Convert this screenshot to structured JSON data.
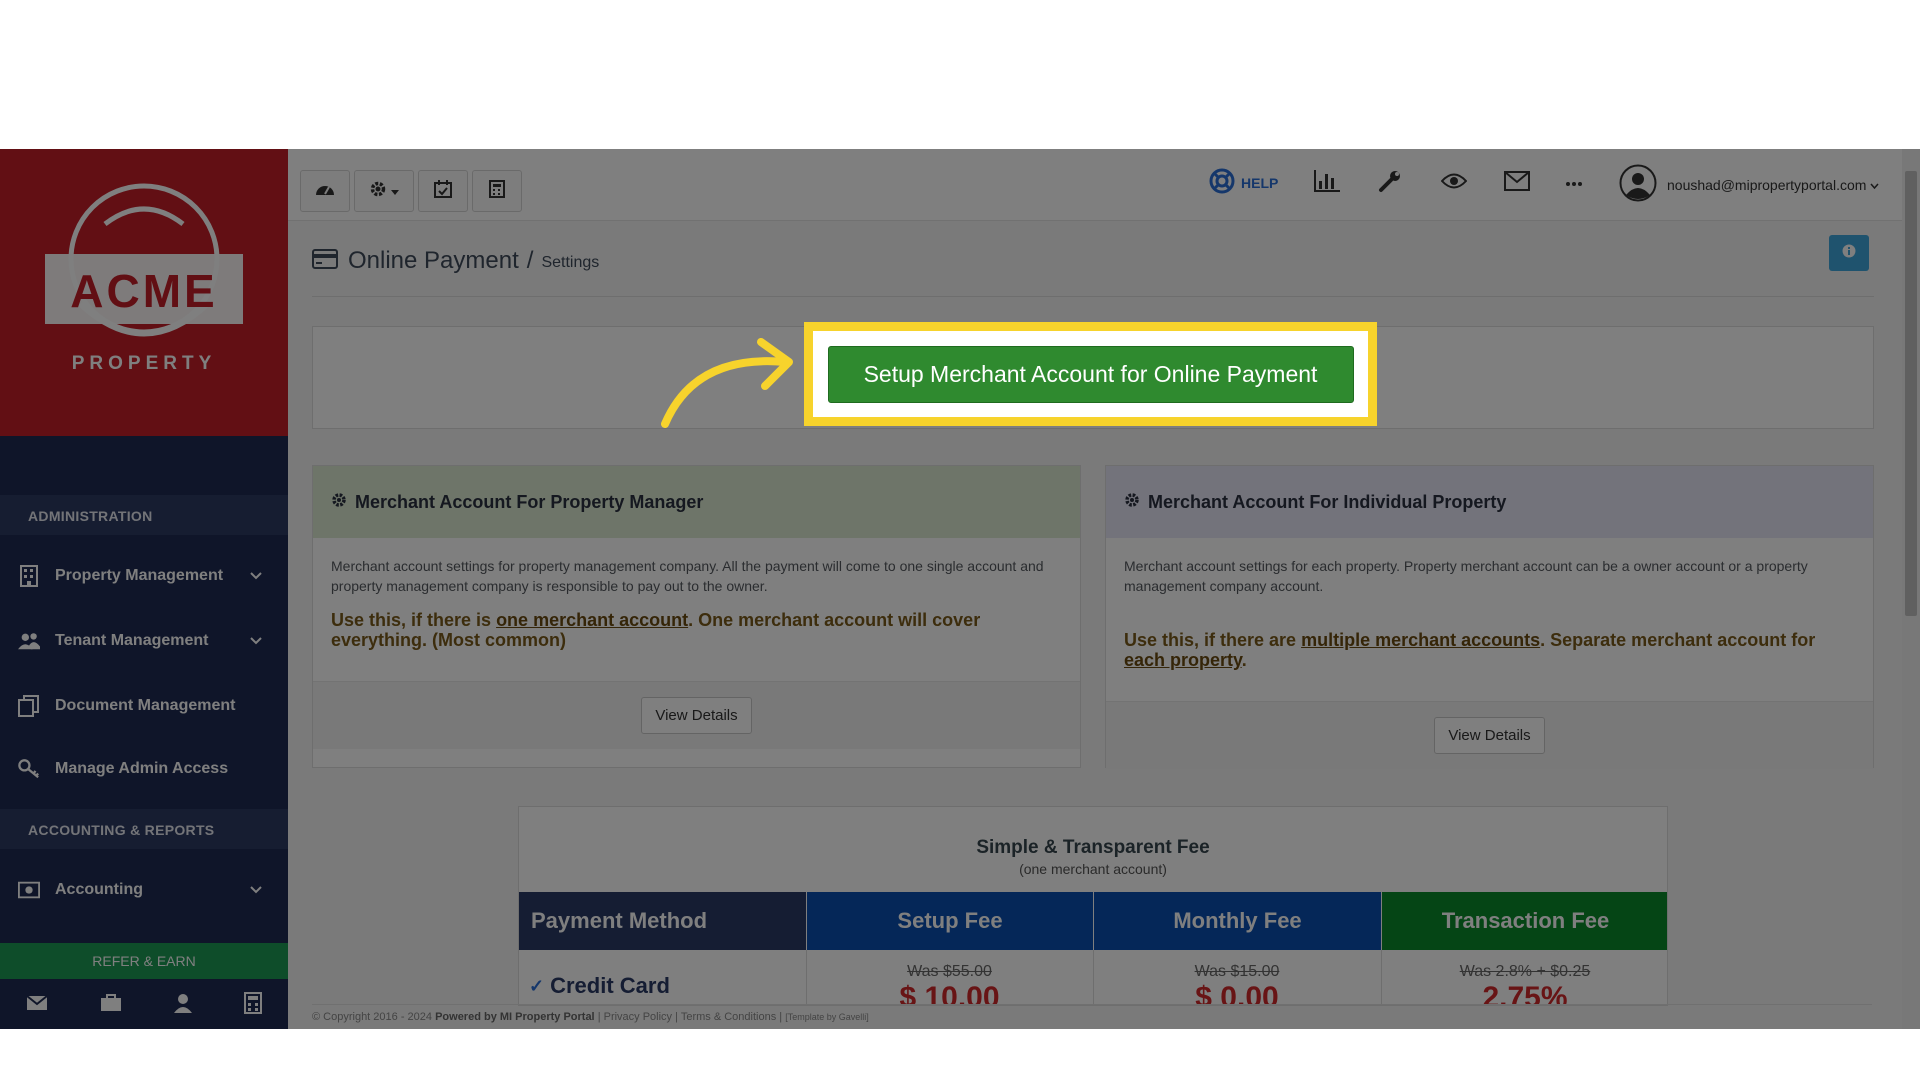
{
  "brand": {
    "logo_main": "ACME",
    "logo_sub": "PROPERTY"
  },
  "sidebar": {
    "section_admin": "ADMINISTRATION",
    "section_accounting": "ACCOUNTING & REPORTS",
    "items": [
      {
        "label": "Property Management",
        "icon": "building-icon"
      },
      {
        "label": "Tenant Management",
        "icon": "users-icon"
      },
      {
        "label": "Document Management",
        "icon": "documents-icon"
      },
      {
        "label": "Manage Admin Access",
        "icon": "key-icon"
      },
      {
        "label": "Accounting",
        "icon": "money-icon"
      }
    ],
    "refer_label": "REFER & EARN"
  },
  "topbar": {
    "help_label": "HELP",
    "user_email": "noushad@mipropertyportal.com"
  },
  "page": {
    "title": "Online Payment",
    "separator": "/",
    "subtitle": "Settings",
    "setup_button": "Setup Merchant Account for Online Payment"
  },
  "cards": {
    "manager": {
      "title": "Merchant Account For Property Manager",
      "desc": "Merchant account settings for property management company. All the payment will come to one single account and property management company is responsible to pay out to the owner.",
      "use_prefix": "Use this, if there is ",
      "use_link": "one merchant account",
      "use_suffix": ". One merchant account will cover everything. (Most common)",
      "button": "View Details"
    },
    "individual": {
      "title": "Merchant Account For Individual Property",
      "desc": "Merchant account settings for each property. Property merchant account can be a owner account or a property management company account.",
      "use_prefix": "Use this, if there are ",
      "use_link": "multiple merchant accounts",
      "use_middle": ". Separate merchant account for ",
      "use_link2": "each property",
      "use_suffix": ".",
      "button": "View Details"
    }
  },
  "fees": {
    "title": "Simple & Transparent Fee",
    "subtitle": "(one merchant account)",
    "headers": [
      "Payment Method",
      "Setup Fee",
      "Monthly Fee",
      "Transaction Fee"
    ],
    "row_label": "Credit Card",
    "setup_was": "Was $55.00",
    "monthly_was": "Was $15.00",
    "transaction_was": "Was 2.8% + $0.25",
    "setup_now": "$ 10.00",
    "monthly_now": "$ 0.00",
    "transaction_now": "2.75%"
  },
  "footer": {
    "copyright": "© Copyright 2016 - 2024",
    "powered": "Powered by MI Property Portal",
    "links": "| Privacy Policy | Terms & Conditions |",
    "template": "[Template by Gavelli]"
  },
  "colors": {
    "logo_red": "#c41e28",
    "sidebar_navy": "#1e2a52",
    "highlight_yellow": "#f7d32c",
    "setup_green": "#2f8a2f",
    "fee_header_dark": "#2b3a66",
    "fee_header_blue": "#0b4fb0",
    "fee_header_green": "#0b8a2a"
  }
}
